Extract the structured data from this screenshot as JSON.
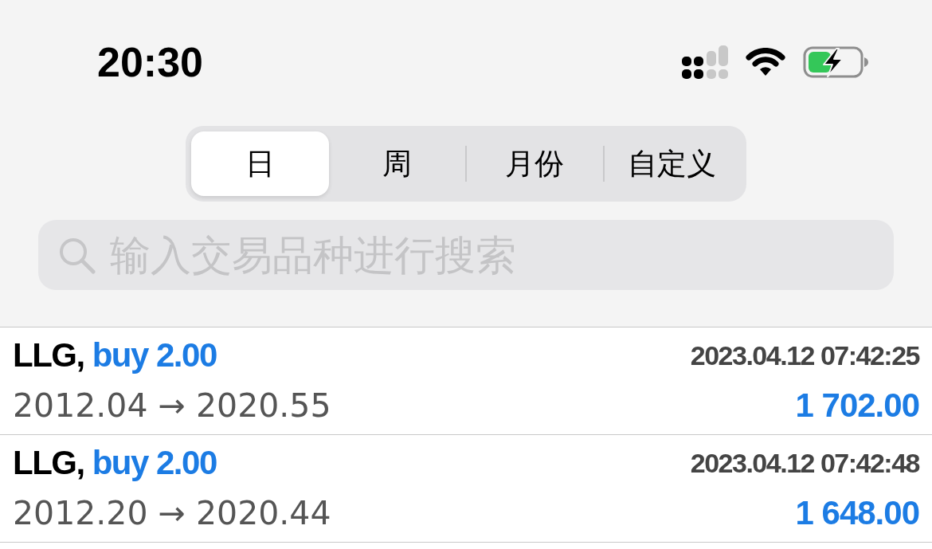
{
  "status_bar": {
    "time": "20:30"
  },
  "segments": [
    {
      "label": "日",
      "selected": true
    },
    {
      "label": "周",
      "selected": false
    },
    {
      "label": "月份",
      "selected": false
    },
    {
      "label": "自定义",
      "selected": false
    }
  ],
  "search": {
    "placeholder": "输入交易品种进行搜索"
  },
  "deals": [
    {
      "symbol": "LLG,",
      "order": "buy 2.00",
      "time": "2023.04.12 07:42:25",
      "prices": "2012.04 → 2020.55",
      "profit": "1 702.00"
    },
    {
      "symbol": "LLG,",
      "order": "buy 2.00",
      "time": "2023.04.12 07:42:48",
      "prices": "2012.20 → 2020.44",
      "profit": "1 648.00"
    }
  ]
}
